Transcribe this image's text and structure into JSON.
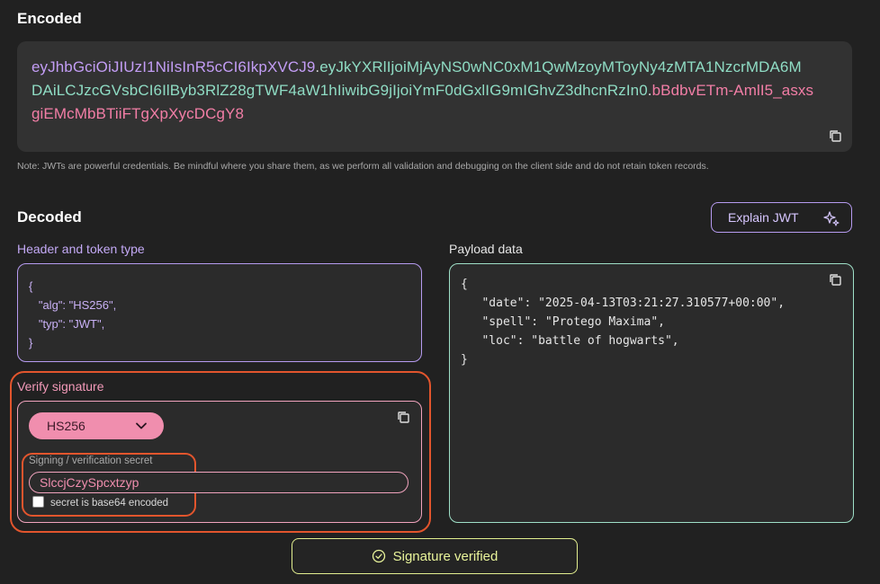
{
  "encoded": {
    "title": "Encoded",
    "lines": [
      {
        "header": "eyJhbGciOiJIUzI1NiIsInR5cCI6IkpXVCJ9",
        "dot1": ".",
        "payload": "eyJkYXRlIjoiMjAyNS0wNC0xM1QwMzoyMToyNy4zMTA1NzcrMDA6M"
      },
      {
        "payload": "DAiLCJzcGVsbCI6IlByb3RlZ28gTWF4aW1hIiwibG9jIjoiYmF0dGxlIG9mIGhvZ3dhcnRzIn0",
        "dot2": ".",
        "signature": "bBdbvETm-AmlI5_asxs"
      },
      {
        "signature": "giEMcMbBTiiFTgXpXycDCgY8"
      }
    ],
    "note": "Note: JWTs are powerful credentials. Be mindful where you share them, as we perform all validation and debugging on the client side and do not retain token records."
  },
  "decoded": {
    "title": "Decoded",
    "explain_button": "Explain JWT",
    "header_label": "Header and token type",
    "header_json": [
      "{",
      "   \"alg\": \"HS256\",",
      "   \"typ\": \"JWT\",",
      "}"
    ],
    "payload_label": "Payload data",
    "payload_json": [
      "{",
      "   \"date\": \"2025-04-13T03:21:27.310577+00:00\",",
      "   \"spell\": \"Protego Maxima\",",
      "   \"loc\": \"battle of hogwarts\",",
      "}"
    ]
  },
  "verify": {
    "title": "Verify signature",
    "algorithm": "HS256",
    "secret_label": "Signing / verification secret",
    "secret_value": "SlccjCzySpcxtzyp",
    "base64_label": "secret is base64 encoded",
    "base64_checked": false
  },
  "status": {
    "text": "Signature verified",
    "color": "#e9f49a"
  },
  "colors": {
    "header_purple": "#c39df5",
    "payload_green": "#8fdcc4",
    "signature_pink": "#f27ea6",
    "highlight_orange": "#e2552d"
  }
}
